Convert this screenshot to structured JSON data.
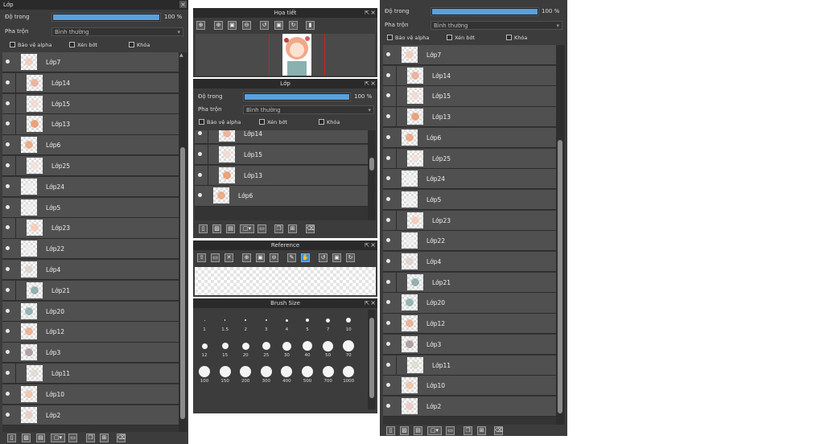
{
  "left_panel": {
    "title": "Lớp",
    "close_icon": "×",
    "opacity_label": "Độ trong",
    "opacity_value": "100 %",
    "opacity_fraction": 1.0,
    "blend_label": "Pha trộn",
    "blend_value": "Bình thường",
    "protect_alpha": "Bảo vệ alpha",
    "clip": "Xén bớt",
    "lock": "Khóa",
    "layers": [
      {
        "name": "Lớp7",
        "indent": false,
        "tint": "#f2c8b4"
      },
      {
        "name": "Lớp14",
        "indent": true,
        "tint": "#e8a890"
      },
      {
        "name": "Lớp15",
        "indent": true,
        "tint": "#f0d8d0"
      },
      {
        "name": "Lớp13",
        "indent": true,
        "tint": "#e89060"
      },
      {
        "name": "Lớp6",
        "indent": false,
        "tint": "#e8a070"
      },
      {
        "name": "Lớp25",
        "indent": true,
        "tint": "#f4e0d8"
      },
      {
        "name": "Lớp24",
        "indent": false,
        "tint": "#eeeeee"
      },
      {
        "name": "Lớp5",
        "indent": false,
        "tint": "#eeeeee"
      },
      {
        "name": "Lớp23",
        "indent": true,
        "tint": "#f6c8b0"
      },
      {
        "name": "Lớp22",
        "indent": false,
        "tint": "#eeeeee"
      },
      {
        "name": "Lớp4",
        "indent": false,
        "tint": "#e0d0c8"
      },
      {
        "name": "Lớp21",
        "indent": true,
        "tint": "#7fa0a0"
      },
      {
        "name": "Lớp20",
        "indent": false,
        "tint": "#80a8a8"
      },
      {
        "name": "Lớp12",
        "indent": false,
        "tint": "#e8a888"
      },
      {
        "name": "Lớp3",
        "indent": false,
        "tint": "#a09090"
      },
      {
        "name": "Lớp11",
        "indent": true,
        "tint": "#e0d8d0"
      },
      {
        "name": "Lớp10",
        "indent": false,
        "tint": "#f0c0a0"
      },
      {
        "name": "Lớp2",
        "indent": false,
        "tint": "#e8c8c0"
      }
    ],
    "scroll_up": "▲",
    "scroll_down": "▼"
  },
  "middle": {
    "preview_title": "Họa tiết",
    "layer_title": "Lớp",
    "opacity_label": "Độ trong",
    "opacity_value": "100 %",
    "opacity_fraction": 1.0,
    "blend_label": "Pha trộn",
    "blend_value": "Bình thường",
    "protect_alpha": "Bảo vệ alpha",
    "clip": "Xén bớt",
    "lock": "Khóa",
    "layers": [
      {
        "name": "Lớp14",
        "indent": true,
        "tint": "#e8a890"
      },
      {
        "name": "Lớp15",
        "indent": true,
        "tint": "#f0d8d0"
      },
      {
        "name": "Lớp13",
        "indent": true,
        "tint": "#e89060"
      },
      {
        "name": "Lớp6",
        "indent": false,
        "tint": "#e8a070"
      }
    ],
    "reference_title": "Reference",
    "brush_title": "Brush Size",
    "brush_sizes": [
      "1",
      "1.5",
      "2",
      "3",
      "4",
      "5",
      "7",
      "10",
      "12",
      "15",
      "20",
      "25",
      "30",
      "40",
      "50",
      "70",
      "100",
      "150",
      "200",
      "300",
      "400",
      "500",
      "700",
      "1000"
    ]
  },
  "right_panel": {
    "opacity_label": "Độ trong",
    "opacity_value": "100 %",
    "opacity_fraction": 1.0,
    "blend_label": "Pha trộn",
    "blend_value": "Bình thường",
    "protect_alpha": "Bảo vệ alpha",
    "clip": "Xén bớt",
    "lock": "Khóa",
    "layers": [
      {
        "name": "Lớp7",
        "indent": false,
        "tint": "#f2c8b4"
      },
      {
        "name": "Lớp14",
        "indent": true,
        "tint": "#e8a890"
      },
      {
        "name": "Lớp15",
        "indent": true,
        "tint": "#f0d8d0"
      },
      {
        "name": "Lớp13",
        "indent": true,
        "tint": "#e89060"
      },
      {
        "name": "Lớp6",
        "indent": false,
        "tint": "#e8a070"
      },
      {
        "name": "Lớp25",
        "indent": true,
        "tint": "#f4e0d8"
      },
      {
        "name": "Lớp24",
        "indent": false,
        "tint": "#eeeeee"
      },
      {
        "name": "Lớp5",
        "indent": false,
        "tint": "#eeeeee"
      },
      {
        "name": "Lớp23",
        "indent": true,
        "tint": "#f6c8b0"
      },
      {
        "name": "Lớp22",
        "indent": false,
        "tint": "#eeeeee"
      },
      {
        "name": "Lớp4",
        "indent": false,
        "tint": "#e0d0c8"
      },
      {
        "name": "Lớp21",
        "indent": true,
        "tint": "#7fa0a0"
      },
      {
        "name": "Lớp20",
        "indent": false,
        "tint": "#80a8a8"
      },
      {
        "name": "Lớp12",
        "indent": false,
        "tint": "#e8a888"
      },
      {
        "name": "Lớp3",
        "indent": false,
        "tint": "#a09090"
      },
      {
        "name": "Lớp11",
        "indent": true,
        "tint": "#e0d8d0"
      },
      {
        "name": "Lớp10",
        "indent": false,
        "tint": "#f0c0a0"
      },
      {
        "name": "Lớp2",
        "indent": false,
        "tint": "#e8c8c0"
      }
    ]
  },
  "colors": {
    "accent": "#5aa0dc",
    "panel": "#3c3c3c",
    "row": "#505050"
  }
}
